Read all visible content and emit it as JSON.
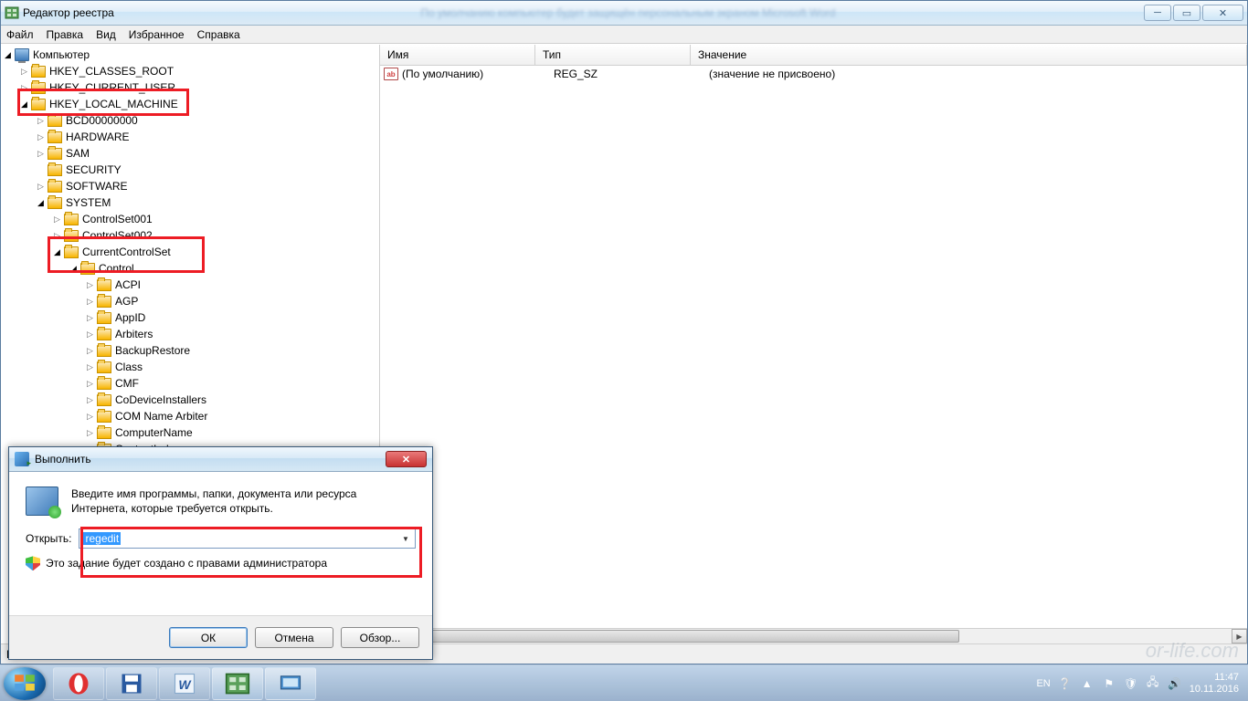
{
  "window": {
    "title": "Редактор реестра",
    "background_blur": "По умолчанию компьютер будет защищён персональным экраном Microsoft Word"
  },
  "menu": [
    "Файл",
    "Правка",
    "Вид",
    "Избранное",
    "Справка"
  ],
  "tree": {
    "root": "Компьютер",
    "hkcr": "HKEY_CLASSES_ROOT",
    "hkcu": "HKEY_CURRENT_USER",
    "hklm": "HKEY_LOCAL_MACHINE",
    "bcd": "BCD00000000",
    "hardware": "HARDWARE",
    "sam": "SAM",
    "security": "SECURITY",
    "software": "SOFTWARE",
    "system": "SYSTEM",
    "cs1": "ControlSet001",
    "cs2": "ControlSet002",
    "ccs": "CurrentControlSet",
    "control": "Control",
    "items": [
      "ACPI",
      "AGP",
      "AppID",
      "Arbiters",
      "BackupRestore",
      "Class",
      "CMF",
      "CoDeviceInstallers",
      "COM Name Arbiter",
      "ComputerName",
      "ContentIndex"
    ]
  },
  "list": {
    "headers": {
      "name": "Имя",
      "type": "Тип",
      "value": "Значение"
    },
    "row": {
      "name": "(По умолчанию)",
      "type": "REG_SZ",
      "value": "(значение не присвоено)",
      "icon": "ab"
    }
  },
  "status": "К",
  "run": {
    "title": "Выполнить",
    "desc": "Введите имя программы, папки, документа или ресурса Интернета, которые требуется открыть.",
    "open_label": "Открыть:",
    "value": "regedit",
    "admin_note": "Это задание будет создано с правами администратора",
    "ok": "ОК",
    "cancel": "Отмена",
    "browse": "Обзор..."
  },
  "tray": {
    "lang": "EN",
    "time": "11:47",
    "date": "10.11.2016"
  },
  "watermark": "or-life.com"
}
